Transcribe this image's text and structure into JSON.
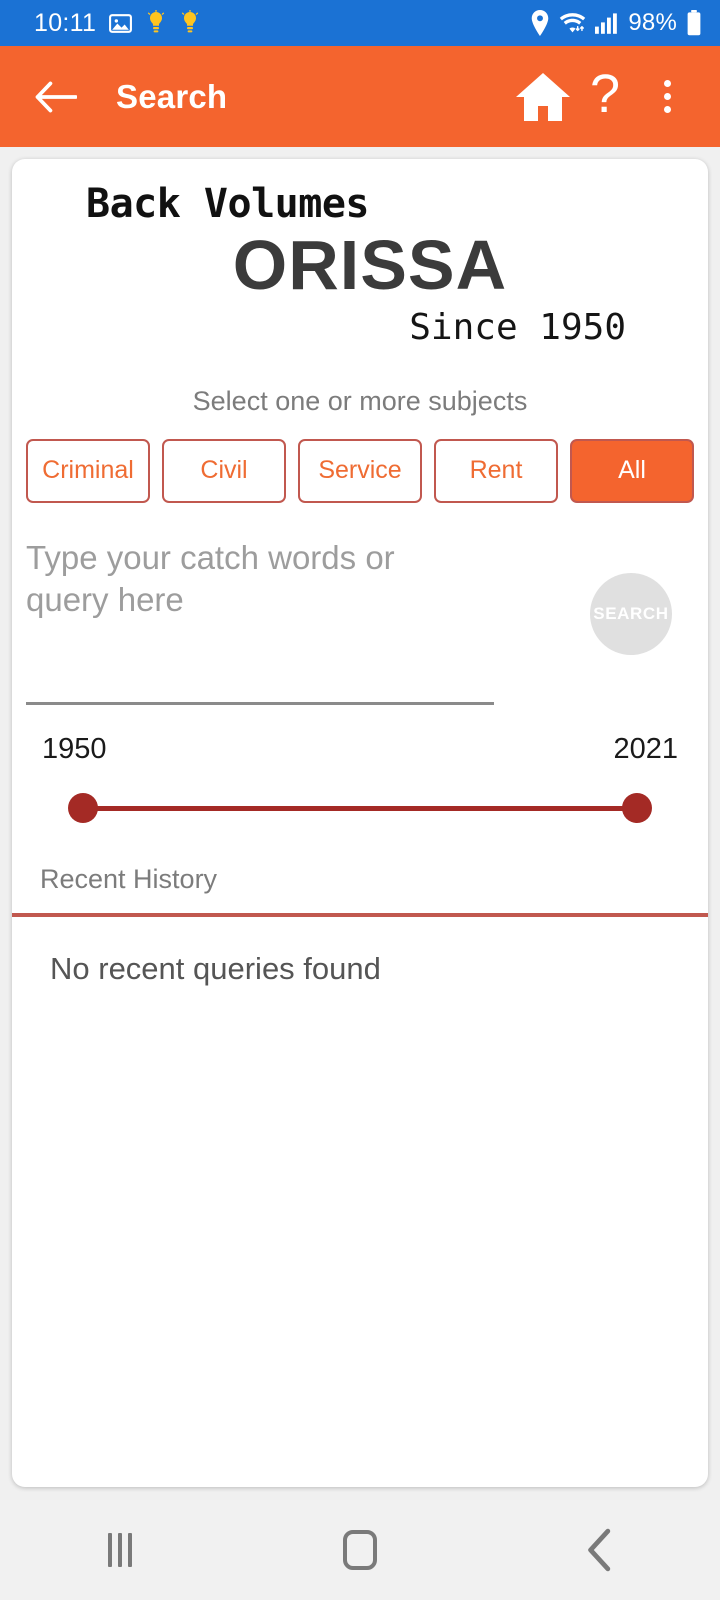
{
  "status_bar": {
    "time": "10:11",
    "battery_text": "98%",
    "icons": [
      "image-icon",
      "lightbulb-icon",
      "lightbulb-icon",
      "location-pin-icon",
      "wifi-icon",
      "cellular-signal-icon",
      "battery-icon"
    ],
    "background_color": "#1b72d4"
  },
  "app_bar": {
    "back_label": "back-arrow",
    "title": "Search",
    "actions": [
      "home-icon",
      "help-icon",
      "overflow-menu-icon"
    ],
    "background_color": "#f4642e"
  },
  "logo": {
    "line1": "Back Volumes",
    "line2": "ORISSA",
    "line3": "Since 1950"
  },
  "subjects": {
    "label": "Select one or more subjects",
    "chips": [
      {
        "label": "Criminal",
        "selected": false
      },
      {
        "label": "Civil",
        "selected": false
      },
      {
        "label": "Service",
        "selected": false
      },
      {
        "label": "Rent",
        "selected": false
      },
      {
        "label": "All",
        "selected": true
      }
    ],
    "outline_color": "#c1584f",
    "text_color": "#ef6c33",
    "selected_fill": "#f4642e"
  },
  "query": {
    "placeholder": "Type your catch words or query here",
    "value": "",
    "search_button_label": "SEARCH",
    "search_button_enabled": false
  },
  "year_range": {
    "min_label": "1950",
    "max_label": "2021",
    "min_value": 1950,
    "max_value": 2021,
    "selected_min": 1950,
    "selected_max": 2021,
    "track_color": "#a42a25"
  },
  "recent_history": {
    "label": "Recent History",
    "divider_color": "#c1584f",
    "empty_message": "No recent queries found",
    "items": []
  },
  "nav_bar": {
    "recents_label": "recents-button",
    "home_label": "home-button",
    "back_label": "back-button"
  }
}
